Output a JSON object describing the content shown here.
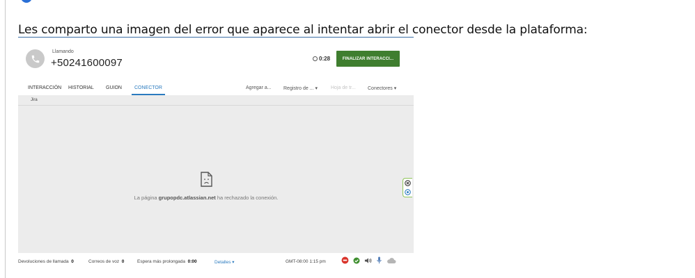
{
  "document": {
    "text": "Les comparto una imagen del error que aparece al intentar abrir el conector desde la plataforma:"
  },
  "call": {
    "status": "Llamando",
    "number": "+50241600097",
    "timer": "0:28",
    "finalize_label": "FINALIZAR INTERACCI..."
  },
  "tabs": [
    "INTERACCIÓN",
    "HISTORIAL",
    "GUION",
    "CONECTOR"
  ],
  "active_tab": "CONECTOR",
  "toolbar": {
    "agregar": "Agregar a...",
    "registro": "Registro de ...  ▾",
    "hoja": "Hoja de tr...",
    "conectores": "Conectores ▾"
  },
  "subtab": "Jira",
  "error": {
    "prefix": "La página ",
    "domain": "grupopdc.atlassian.net",
    "suffix": " ha rechazado la conexión."
  },
  "status_bar": {
    "callbacks_label": "Devoluciones de llamada",
    "callbacks_value": "0",
    "voicemail_label": "Correos de voz",
    "voicemail_value": "0",
    "longest_wait_label": "Espera más prolongada",
    "longest_wait_value": "0:00",
    "details_label": "Detalles ▾",
    "timezone": "GMT-08:00 1:15 pm"
  },
  "colors": {
    "finalize_green": "#3f7e2f",
    "accent_blue": "#2b7bbf",
    "status_red": "#d9342b",
    "status_green": "#3f8f2f"
  }
}
